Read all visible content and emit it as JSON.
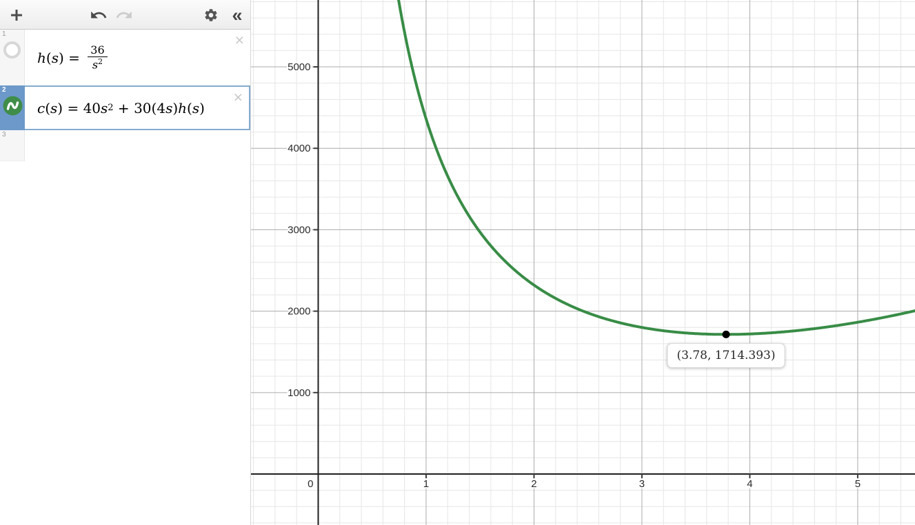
{
  "app_name": "graphing-calculator",
  "colors": {
    "curve_green": "#388c46",
    "selected_gutter_blue": "#6d99ca",
    "selected_border_blue": "#84abd1",
    "grid_minor": "#e6e6e6",
    "grid_major": "#ababab",
    "axis": "#1f1f1f",
    "point": "#000000"
  },
  "toolbar": {
    "add_expression_tooltip": "Add Item",
    "collapse_glyph": "«"
  },
  "expressions": {
    "rows": [
      {
        "index": "1",
        "selected": false,
        "visibility": "hidden",
        "close_label": "×",
        "tokens": [
          {
            "t": "h",
            "i": 1
          },
          {
            "t": "(",
            "i": 0
          },
          {
            "t": "s",
            "i": 1
          },
          {
            "t": ")",
            "i": 0
          },
          {
            "t": " = ",
            "i": 0
          },
          {
            "frac": {
              "num": [
                {
                  "t": "36",
                  "i": 0
                }
              ],
              "den": [
                {
                  "t": "s",
                  "i": 1
                },
                {
                  "t": "2",
                  "i": 0,
                  "sup": 1
                }
              ]
            }
          }
        ]
      },
      {
        "index": "2",
        "selected": true,
        "visibility": "visible",
        "close_label": "×",
        "tokens": [
          {
            "t": "c",
            "i": 1
          },
          {
            "t": "(",
            "i": 0
          },
          {
            "t": "s",
            "i": 1
          },
          {
            "t": ")",
            "i": 0
          },
          {
            "t": " = ",
            "i": 0
          },
          {
            "t": "40",
            "i": 0
          },
          {
            "t": "s",
            "i": 1
          },
          {
            "t": "2",
            "i": 0,
            "sup": 1
          },
          {
            "t": " + ",
            "i": 0
          },
          {
            "t": "30",
            "i": 0
          },
          {
            "t": "(",
            "i": 0
          },
          {
            "t": "4",
            "i": 0
          },
          {
            "t": "s",
            "i": 1
          },
          {
            "t": ")",
            "i": 0
          },
          {
            "t": "h",
            "i": 1
          },
          {
            "t": "(",
            "i": 0
          },
          {
            "t": "s",
            "i": 1
          },
          {
            "t": ")",
            "i": 0
          }
        ]
      },
      {
        "index": "3",
        "selected": false,
        "visibility": "empty",
        "close_label": "",
        "tokens": []
      }
    ]
  },
  "chart_data": {
    "type": "line",
    "expressions_latex": [
      "h(s)=36/s^2",
      "c(s)=40s^2+30(4s)h(s)"
    ],
    "curve": {
      "form": "a*s^2 + b/s",
      "a": 40,
      "b": 4320,
      "color": "#388c46",
      "width": 4
    },
    "x_axis": {
      "min": -0.623,
      "max": 5.531,
      "major_step": 1,
      "minor_step": 0.2,
      "tick_labels": [
        "0",
        "1",
        "2",
        "3",
        "4",
        "5"
      ]
    },
    "y_axis": {
      "min": -626,
      "max": 5821,
      "major_step": 1000,
      "minor_step": 200,
      "tick_labels": [
        "1000",
        "2000",
        "3000",
        "4000",
        "5000"
      ]
    },
    "grid": true,
    "point": {
      "x": 3.78,
      "y": 1714.393,
      "label": "(3.78, 1714.393)"
    }
  }
}
